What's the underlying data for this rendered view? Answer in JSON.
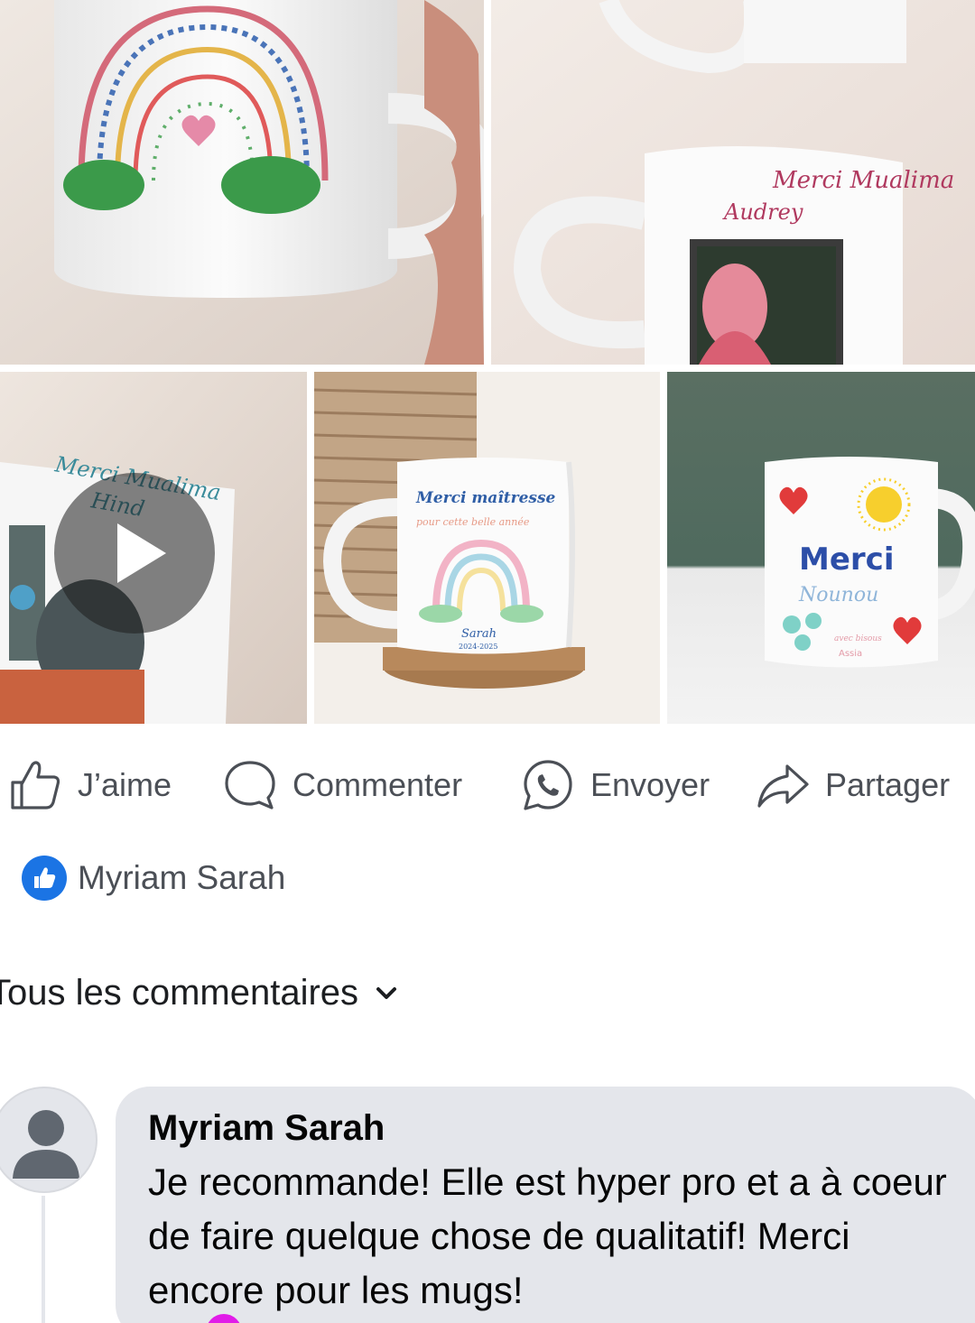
{
  "post_images": [
    {
      "id": "rainbow-mug",
      "alt": "",
      "mug_text": ""
    },
    {
      "id": "mualima-audrey-mug",
      "mug_text": "Merci Mualima",
      "mug_name": "Audrey"
    },
    {
      "id": "mualima-hind-video",
      "mug_text": "Merci Mualima",
      "mug_name": "Hind"
    },
    {
      "id": "maitresse-mug",
      "mug_text": "Merci maîtresse",
      "mug_sub": "pour cette belle année",
      "mug_name": "Sarah",
      "mug_year": "2024-2025"
    },
    {
      "id": "nounou-mug",
      "mug_text": "Merci",
      "mug_sub": "Nounou",
      "mug_foot": "avec bisous",
      "mug_name": "Assia"
    }
  ],
  "actions": {
    "like": "J’aime",
    "comment": "Commenter",
    "send": "Envoyer",
    "share": "Partager"
  },
  "likes": {
    "names": "Myriam Sarah"
  },
  "comments_filter": {
    "label": "Tous les commentaires"
  },
  "comment": {
    "author": "Myriam Sarah",
    "text": "Je recommande! Elle est hyper pro et a à coeur de faire quelque chose de qualitatif! Merci encore pour les mugs!"
  },
  "colors": {
    "brand_blue": "#1b74e4",
    "bubble": "#e4e6eb",
    "action_text": "#4b4f56"
  },
  "icons": [
    "thumbs-up-icon",
    "comment-icon",
    "whatsapp-icon",
    "share-icon",
    "play-icon",
    "sound-icon",
    "chevron-down-icon",
    "avatar-icon"
  ]
}
